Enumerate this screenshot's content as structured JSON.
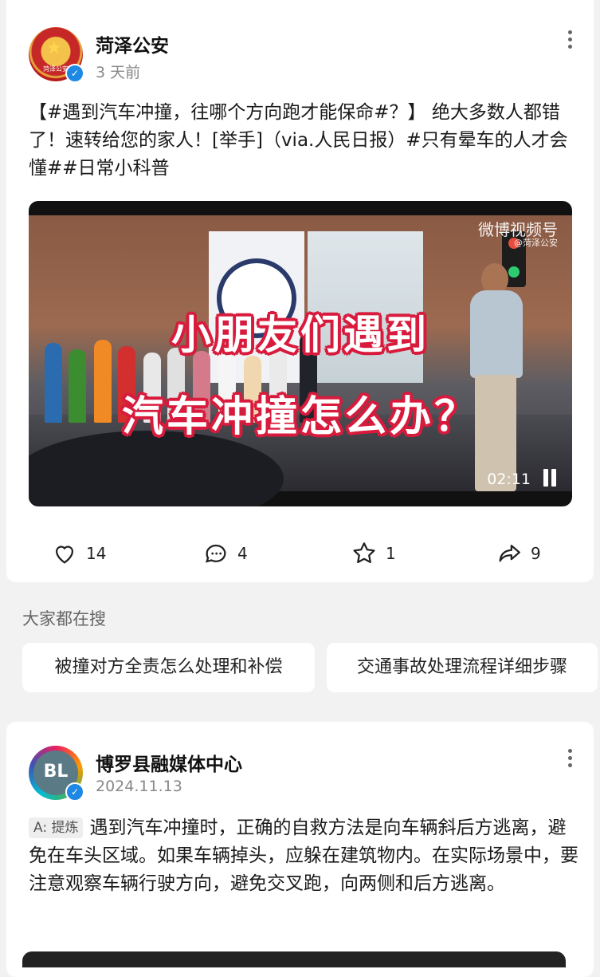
{
  "post1": {
    "author": "菏泽公安",
    "avatar_seal_text": "菏泽公安",
    "time": "3 天前",
    "text": "【#遇到汽车冲撞，往哪个方向跑才能保命#？】 绝大多数人都错了！速转给您的家人！[举手]（via.人民日报）#只有晕车的人才会懂##日常小科普",
    "video": {
      "overlay_line1": "小朋友们遇到",
      "overlay_line2": "汽车冲撞怎么办？",
      "watermark": "微博视频号",
      "watermark_sub": "@菏泽公安",
      "duration": "02:11"
    },
    "actions": {
      "likes": "14",
      "comments": "4",
      "favorites": "1",
      "shares": "9"
    }
  },
  "search": {
    "title": "大家都在搜",
    "chips": [
      "被撞对方全责怎么处理和补偿",
      "交通事故处理流程详细步骤"
    ]
  },
  "post2": {
    "author": "博罗县融媒体中心",
    "time": "2024.11.13",
    "ai_tag": "A: 提炼",
    "text": "遇到汽车冲撞时，正确的自救方法是向车辆斜后方逃离，避免在车头区域。如果车辆掉头，应躲在建筑物内。在实际场景中，要注意观察车辆行驶方向，避免交叉跑，向两侧和后方逃离。"
  },
  "colors": {
    "accent_red": "#d81b3c",
    "verify_blue": "#1e88e5"
  }
}
